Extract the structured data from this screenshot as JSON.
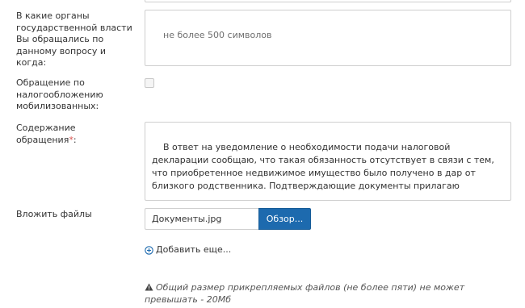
{
  "form": {
    "organs": {
      "label": "В какие органы государственной власти Вы обращались по данному вопросу и когда:",
      "placeholder": "не более 500 символов"
    },
    "mobilized": {
      "label": "Обращение по налогообложению мобилизованных:",
      "checked": false
    },
    "content": {
      "label": "Содержание обращения",
      "required_mark": "*",
      "label_suffix": ":",
      "value": "В ответ на уведомление о необходимости подачи налоговой декларации сообщаю, что такая обязанность отсутствует в связи с тем, что приобретенное недвижимое имущество было получено в дар от близкого родственника. Подтверждающие документы прилагаю"
    },
    "files": {
      "label": "Вложить файлы",
      "file_name": "Документы.jpg",
      "browse_label": "Обзор...",
      "add_more_label": "Добавить еще...",
      "note": "Общий размер прикрепляемых файлов (не более пяти) не может превышать - 20Мб"
    }
  },
  "colors": {
    "accent": "#1d6aae",
    "required": "#d9534f",
    "border": "#cfcfcf"
  },
  "icons": {
    "add": "plus-circle-icon",
    "warning": "warning-triangle-icon"
  }
}
